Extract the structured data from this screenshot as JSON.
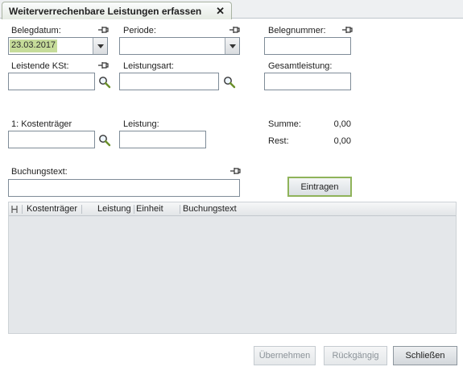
{
  "tab": {
    "title": "Weiterverrechenbare Leistungen erfassen",
    "close_icon": "close-icon"
  },
  "form": {
    "belegdatum": {
      "label": "Belegdatum:",
      "value": "23.03.2017"
    },
    "periode": {
      "label": "Periode:",
      "value": ""
    },
    "belegnummer": {
      "label": "Belegnummer:",
      "value": ""
    },
    "leistende_kst": {
      "label": "Leistende KSt:",
      "value": ""
    },
    "leistungsart": {
      "label": "Leistungsart:",
      "value": ""
    },
    "gesamtleistung": {
      "label": "Gesamtleistung:",
      "value": ""
    },
    "kostentraeger": {
      "label": "1: Kostenträger",
      "value": ""
    },
    "leistung": {
      "label": "Leistung:",
      "value": ""
    },
    "summe": {
      "label": "Summe:",
      "value": "0,00"
    },
    "rest": {
      "label": "Rest:",
      "value": "0,00"
    },
    "buchungstext": {
      "label": "Buchungstext:",
      "value": ""
    },
    "eintragen_label": "Eintragen"
  },
  "grid": {
    "columns": [
      "Kostenträger",
      "Leistung",
      "Einheit",
      "Buchungstext"
    ],
    "rows": []
  },
  "footer": {
    "uebernehmen_label": "Übernehmen",
    "rueckgaengig_label": "Rückgängig",
    "schliessen_label": "Schließen"
  },
  "colors": {
    "accent_green": "#8fb35a",
    "selection": "#c6dc9a",
    "grid_bg": "#e4e7ea"
  }
}
